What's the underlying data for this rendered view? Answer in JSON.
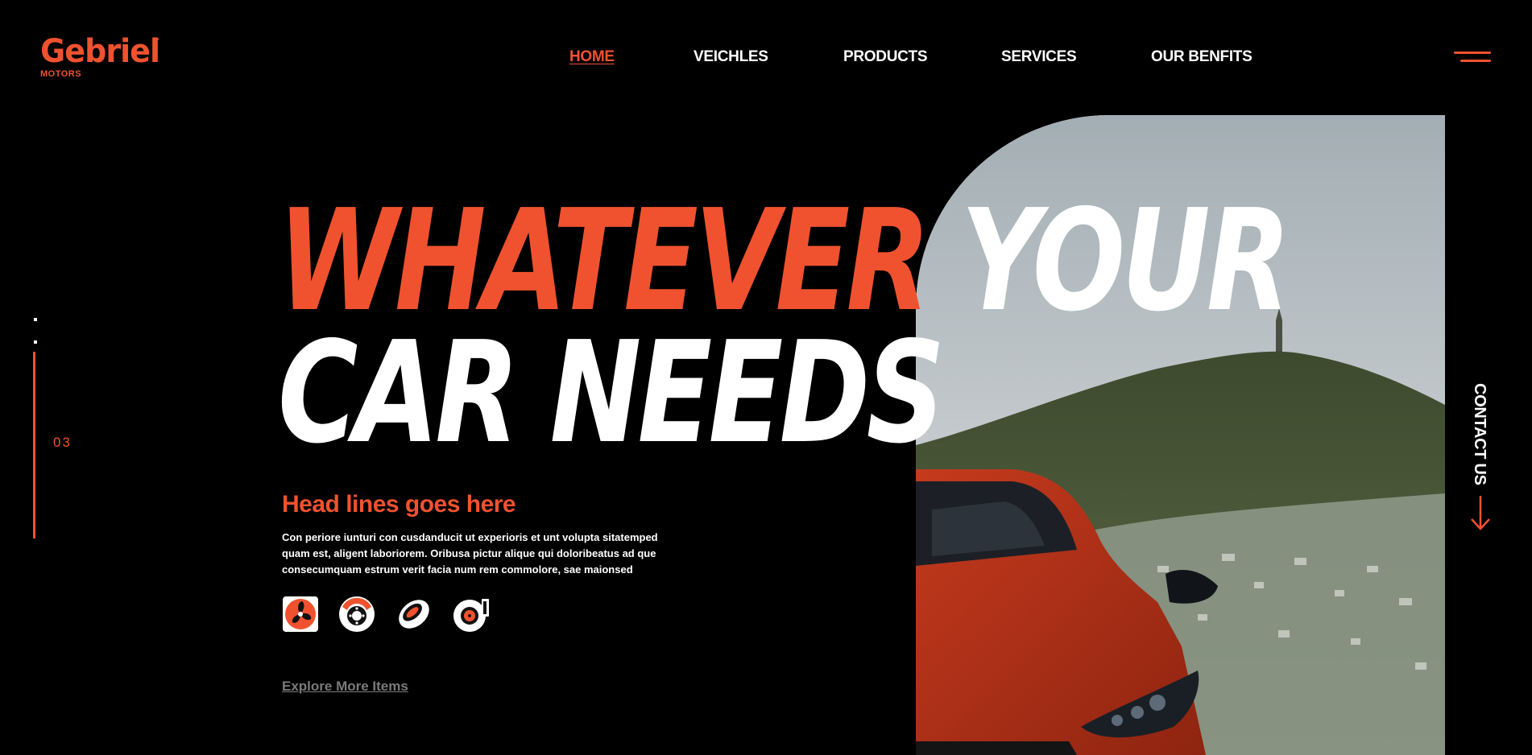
{
  "brand": {
    "name": "Gebriel",
    "trademark": "™",
    "subtitle": "MOTORS"
  },
  "nav": {
    "items": [
      {
        "label": "HOME",
        "active": true
      },
      {
        "label": "VEICHLES",
        "active": false
      },
      {
        "label": "PRODUCTS",
        "active": false
      },
      {
        "label": "SERVICES",
        "active": false
      },
      {
        "label": "OUR BENFITS",
        "active": false
      }
    ],
    "menu_icon": "hamburger-icon"
  },
  "slider": {
    "current": "03"
  },
  "hero": {
    "headline_accent": "WHATEVER",
    "headline_rest_line1": "YOUR",
    "headline_line2": "CAR NEEDS",
    "subheading": "Head lines goes here",
    "description": "Con periore iunturi con cusdanducit ut experioris et unt volupta sitatemped quam est, aligent laboriorem. Oribusa pictur alique qui doloribeatus ad que consecumquam estrum verit facia num rem commolore, sae maionsed",
    "icons": [
      "fan-icon",
      "brake-disc-icon",
      "tire-icon",
      "turbo-icon"
    ],
    "cta": "Explore More Items"
  },
  "contact": {
    "label": "CONTACT US",
    "icon": "arrow-down-icon"
  },
  "colors": {
    "accent": "#f0522f",
    "background": "#000000",
    "text": "#ffffff",
    "muted": "#7a7a7a"
  }
}
